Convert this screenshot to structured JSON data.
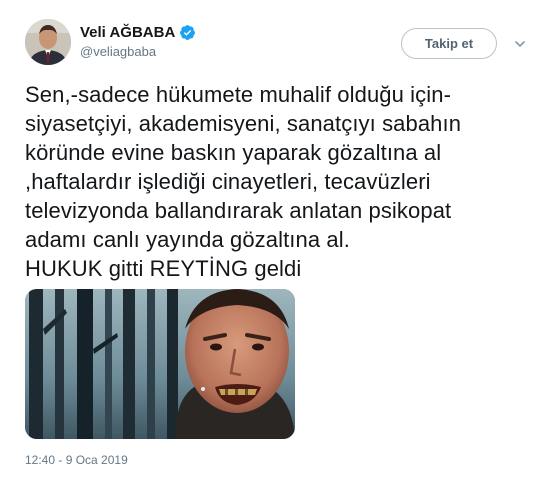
{
  "user": {
    "display_name": "Veli AĞBABA",
    "handle": "@veliagbaba",
    "verified_icon": "verified-badge-icon",
    "verified_color": "#1da1f2"
  },
  "actions": {
    "follow_label": "Takip et",
    "menu_icon": "chevron-down-icon"
  },
  "tweet": {
    "lines": [
      "Sen,-sadece hükumete muhalif olduğu için-",
      "siyasetçiyi, akademisyeni, sanatçıyı sabahın",
      "köründe evine baskın yaparak gözaltına al",
      ",haftalardır işlediği cinayetleri, tecavüzleri",
      "televizyonda ballandırarak anlatan psikopat",
      "adamı canlı yayında gözaltına al.",
      "HUKUK gitti REYTİNG geldi"
    ],
    "timestamp": "12:40 - 9 Oca 2019"
  },
  "colors": {
    "text": "#14171a",
    "secondary": "#657786",
    "border": "#b8c4cc"
  }
}
